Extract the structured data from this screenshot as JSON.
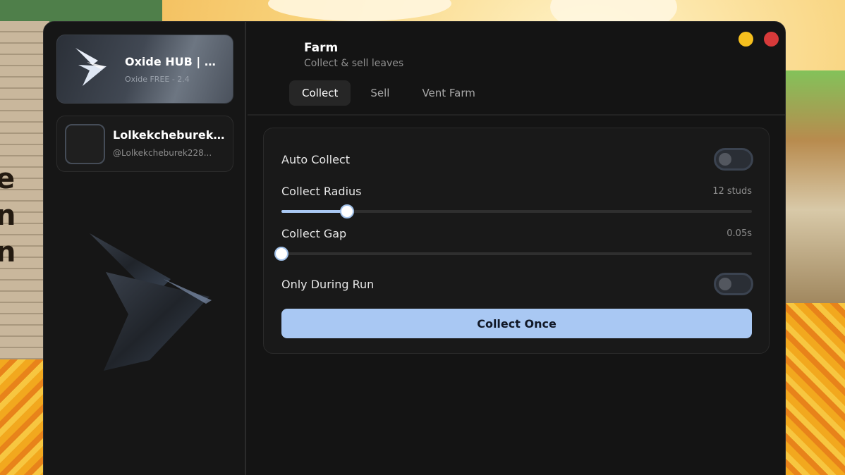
{
  "background": {
    "left_sign_text": "e\nn\nn"
  },
  "sidebar": {
    "hub": {
      "title": "Oxide HUB | 🍂...",
      "subtitle": "Oxide FREE - 2.4"
    },
    "user": {
      "display_name": "Lolkekcheburek2...",
      "handle": "@Lolkekcheburek228..."
    }
  },
  "header": {
    "title": "Farm",
    "subtitle": "Collect & sell leaves"
  },
  "tabs": [
    {
      "label": "Collect",
      "active": true
    },
    {
      "label": "Sell",
      "active": false
    },
    {
      "label": "Vent Farm",
      "active": false
    }
  ],
  "settings": {
    "auto_collect": {
      "label": "Auto Collect",
      "enabled": false
    },
    "collect_radius": {
      "label": "Collect Radius",
      "value_text": "12 studs",
      "fraction": 0.14
    },
    "collect_gap": {
      "label": "Collect Gap",
      "value_text": "0.05s",
      "fraction": 0.0
    },
    "only_during_run": {
      "label": "Only During Run",
      "enabled": false
    },
    "collect_once": {
      "label": "Collect Once"
    }
  },
  "colors": {
    "accent": "#a9c8f3",
    "minimize": "#f5bf1e",
    "close": "#d73a3a",
    "panel_bg": "#191919"
  }
}
